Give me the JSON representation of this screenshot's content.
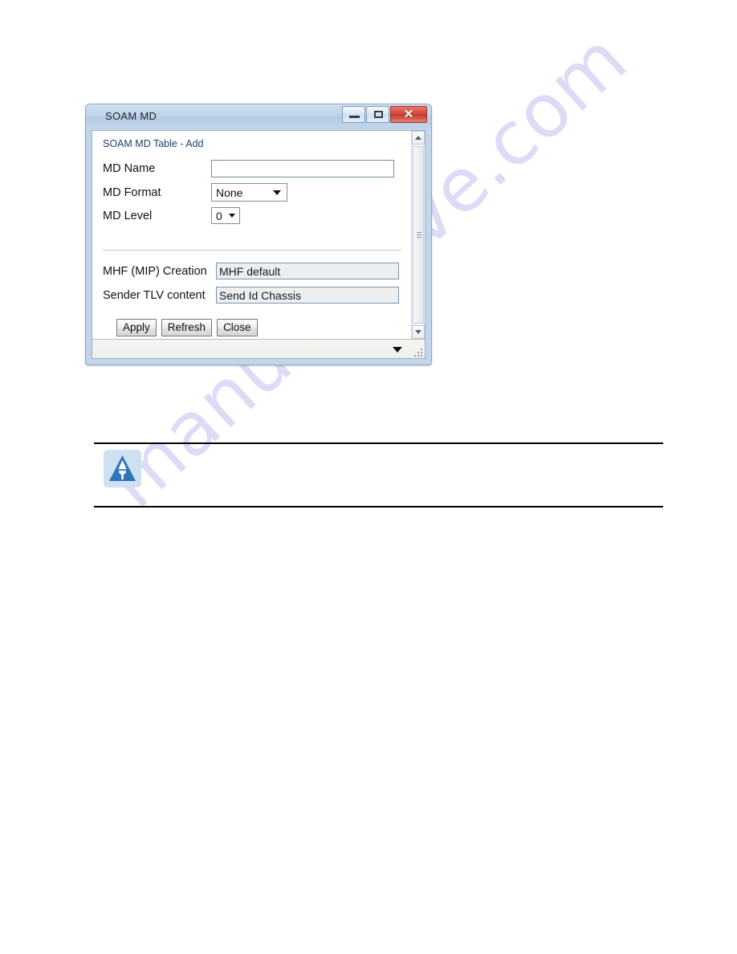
{
  "page": {
    "watermark_text": "manualshive.com",
    "watermark_color": "#c9c6ef"
  },
  "dialog": {
    "title": "SOAM MD",
    "titlebar_color": "#bdd2e8",
    "window_controls": {
      "minimize": "minimize-icon",
      "maximize": "maximize-icon",
      "close": "✕",
      "close_color": "#d4483b"
    },
    "panel": {
      "header": "SOAM MD Table - Add",
      "header_color": "#1f3f6b",
      "fields": [
        {
          "label": "MD Name",
          "type": "text",
          "value": "",
          "placeholder": ""
        },
        {
          "label": "MD Format",
          "type": "select",
          "value": "None"
        },
        {
          "label": "MD Level",
          "type": "select",
          "value": "0"
        },
        {
          "label": "MHF (MIP) Creation",
          "type": "readonly",
          "value": "MHF default"
        },
        {
          "label": "Sender TLV content",
          "type": "readonly",
          "value": "Send Id Chassis"
        }
      ],
      "buttons": [
        {
          "label": "Apply"
        },
        {
          "label": "Refresh"
        },
        {
          "label": "Close"
        }
      ]
    },
    "scrollbar": {
      "up_arrow": "scroll-up-icon",
      "down_arrow": "scroll-down-icon"
    },
    "statusbar": {
      "dropdown": "status-dropdown-icon",
      "resize": "resize-grip-icon"
    }
  },
  "note": {
    "icon_name": "note-triangle-icon",
    "icon_bg": "#cfe0f2",
    "icon_fg": "#2e75b6",
    "text": ""
  }
}
